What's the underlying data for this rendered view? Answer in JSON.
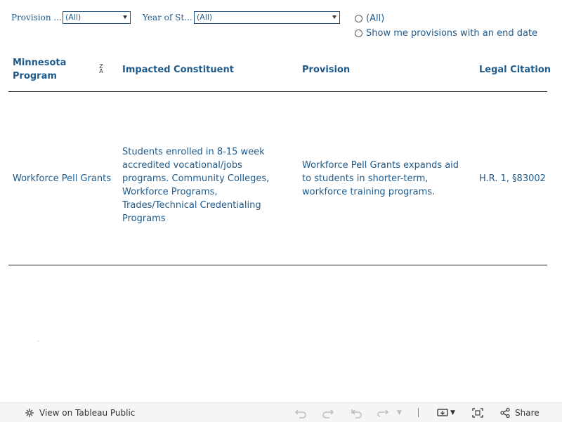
{
  "filters": {
    "provision_label": "Provision ...",
    "provision_value": "(All)",
    "year_label": "Year of St...",
    "year_value": "(All)"
  },
  "radio_options": [
    "(All)",
    "Show me provisions with an end date"
  ],
  "table": {
    "headers": {
      "program": "Minnesota Program",
      "constituent": "Impacted Constituent",
      "provision": "Provision",
      "citation": "Legal Citation"
    },
    "sort_icon": "sort-desc-icon",
    "rows": [
      {
        "program": "Workforce Pell Grants",
        "constituent": "Students enrolled in 8-15 week accredited vocational/jobs programs. Community Colleges, Workforce Programs, Trades/Technical Credentialing Programs",
        "provision": "Workforce Pell Grants expands aid to students in shorter-term, workforce training programs.",
        "citation": "H.R. 1, §83002"
      }
    ]
  },
  "toolbar": {
    "view_label": "View on Tableau Public",
    "share_label": "Share"
  },
  "colors": {
    "text_blue": "#1f5a8a",
    "rule": "#222222",
    "toolbar_bg": "#f5f5f5"
  }
}
